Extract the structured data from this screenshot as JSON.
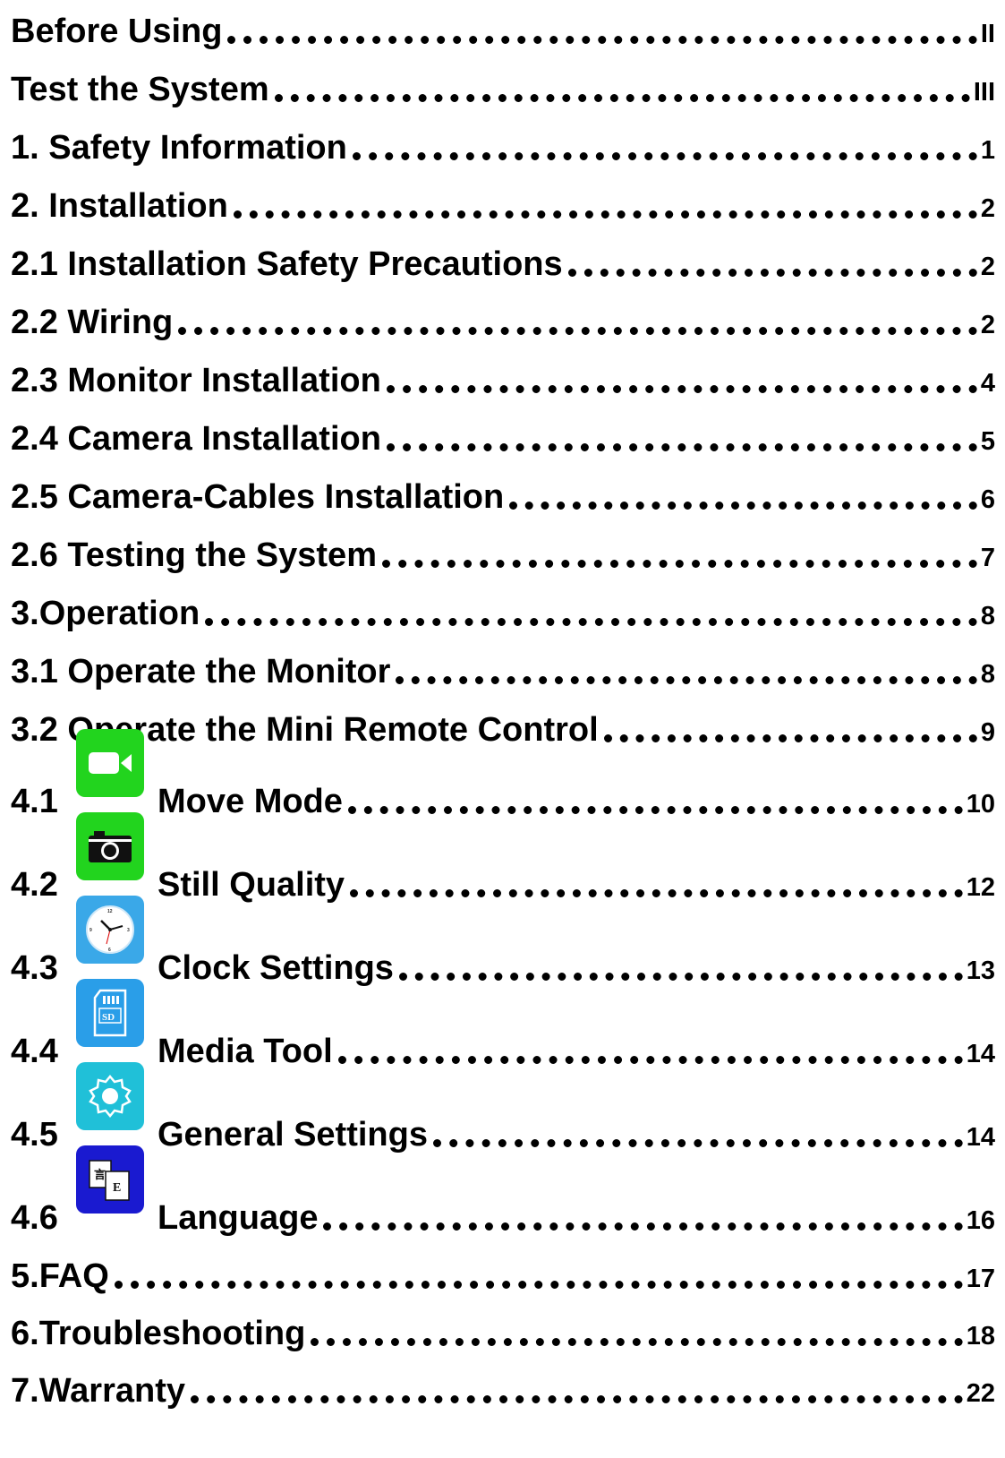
{
  "toc": {
    "entries": [
      {
        "title": "Before Using",
        "page": "II"
      },
      {
        "title": "Test the System",
        "page": "III"
      },
      {
        "title": "1. Safety Information",
        "page": "1"
      },
      {
        "title": "2. Installation",
        "page": "2"
      },
      {
        "title": "2.1 Installation Safety Precautions",
        "page": "2"
      },
      {
        "title": "2.2 Wiring",
        "page": "2"
      },
      {
        "title": "2.3 Monitor Installation",
        "page": "4"
      },
      {
        "title": "2.4 Camera Installation",
        "page": "5"
      },
      {
        "title": "2.5 Camera-Cables Installation",
        "page": "6"
      },
      {
        "title": "2.6 Testing the System",
        "page": "7"
      },
      {
        "title": "3.Operation",
        "page": "8"
      },
      {
        "title": "3.1 Operate the Monitor",
        "page": "8"
      },
      {
        "title": "3.2 Operate the Mini Remote Control",
        "page": "9"
      }
    ],
    "icon_entries": [
      {
        "num": "4.1",
        "title": "Move Mode",
        "page": "10",
        "icon": "video-camera-icon",
        "color": "#22d41e"
      },
      {
        "num": "4.2",
        "title": "Still Quality",
        "page": "12",
        "icon": "photo-camera-icon",
        "color": "#22d41e"
      },
      {
        "num": "4.3",
        "title": "Clock Settings",
        "page": "13",
        "icon": "clock-icon",
        "color": "#3aa8e8"
      },
      {
        "num": "4.4",
        "title": "Media Tool",
        "page": "14",
        "icon": "sd-card-icon",
        "color": "#2a9ee8"
      },
      {
        "num": "4.5",
        "title": "General Settings",
        "page": "14",
        "icon": "gear-icon",
        "color": "#20c0d8"
      },
      {
        "num": "4.6",
        "title": "Language",
        "page": "16",
        "icon": "language-icon",
        "color": "#1a1ad0"
      }
    ],
    "tail_entries": [
      {
        "title": "5.FAQ",
        "page": "17"
      },
      {
        "title": "6.Troubleshooting",
        "page": "18"
      },
      {
        "title": "7.Warranty",
        "page": "22"
      }
    ]
  }
}
